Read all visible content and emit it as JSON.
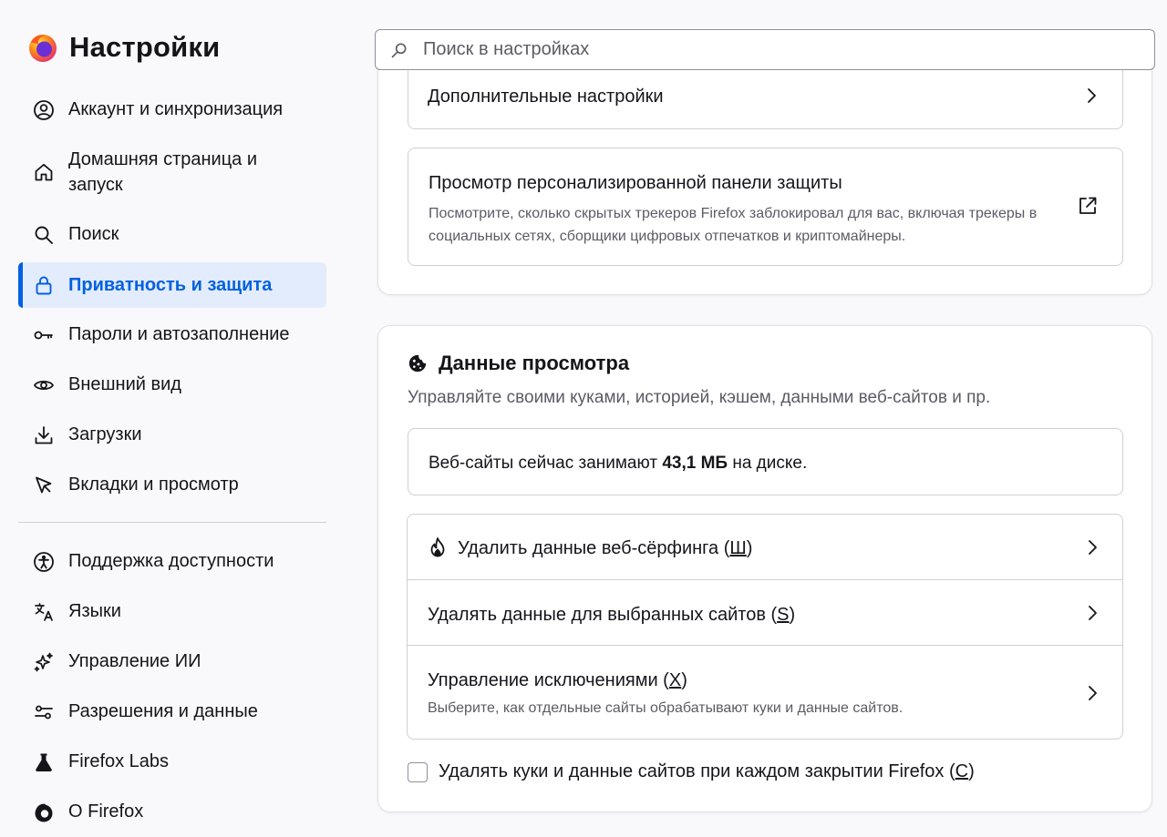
{
  "app": {
    "title": "Настройки"
  },
  "search": {
    "placeholder": "Поиск в настройках"
  },
  "sidebar": {
    "items": [
      {
        "label": "Аккаунт и синхронизация",
        "icon": "account-icon"
      },
      {
        "label": "Домашняя страница и запуск",
        "icon": "home-icon"
      },
      {
        "label": "Поиск",
        "icon": "search-icon"
      },
      {
        "label": "Приватность и защита",
        "icon": "lock-icon",
        "active": true
      },
      {
        "label": "Пароли и автозаполнение",
        "icon": "key-icon"
      },
      {
        "label": "Внешний вид",
        "icon": "eye-icon"
      },
      {
        "label": "Загрузки",
        "icon": "download-icon"
      },
      {
        "label": "Вкладки и просмотр",
        "icon": "cursor-icon"
      }
    ],
    "bottom_items": [
      {
        "label": "Поддержка доступности",
        "icon": "accessibility-icon"
      },
      {
        "label": "Языки",
        "icon": "translate-icon"
      },
      {
        "label": "Управление ИИ",
        "icon": "sparkle-icon"
      },
      {
        "label": "Разрешения и данные",
        "icon": "sliders-icon"
      },
      {
        "label": "Firefox Labs",
        "icon": "flask-icon"
      },
      {
        "label": "О Firefox",
        "icon": "firefox-icon"
      }
    ]
  },
  "protection": {
    "advanced_label": "Дополнительные настройки",
    "dashboard_title": "Просмотр персонализированной панели защиты",
    "dashboard_desc": "Посмотрите, сколько скрытых трекеров Firefox заблокировал для вас, включая трекеры в социальных сетях, сборщики цифровых отпечатков и криптомайнеры."
  },
  "browsing_data": {
    "title": "Данные просмотра",
    "description": "Управляйте своими куками, историей, кэшем, данными веб-сайтов и пр.",
    "usage_prefix": "Веб-сайты сейчас занимают ",
    "usage_value": "43,1 МБ",
    "usage_suffix": " на диске.",
    "clear_label": "Удалить данные веб-сёрфинга (",
    "clear_key": "Ш",
    "close_paren": ")",
    "clear_sites_label": "Удалять данные для выбранных сайтов (",
    "clear_sites_key": "S",
    "exceptions_label": "Управление исключениями (",
    "exceptions_key": "X",
    "exceptions_desc": "Выберите, как отдельные сайты обрабатывают куки и данные сайтов.",
    "delete_on_close_label": "Удалять куки и данные сайтов при каждом закрытии Firefox (",
    "delete_on_close_key": "C",
    "delete_on_close_checked": false
  },
  "colors": {
    "accent": "#0061e0",
    "active_bg": "#e3ecfc"
  }
}
